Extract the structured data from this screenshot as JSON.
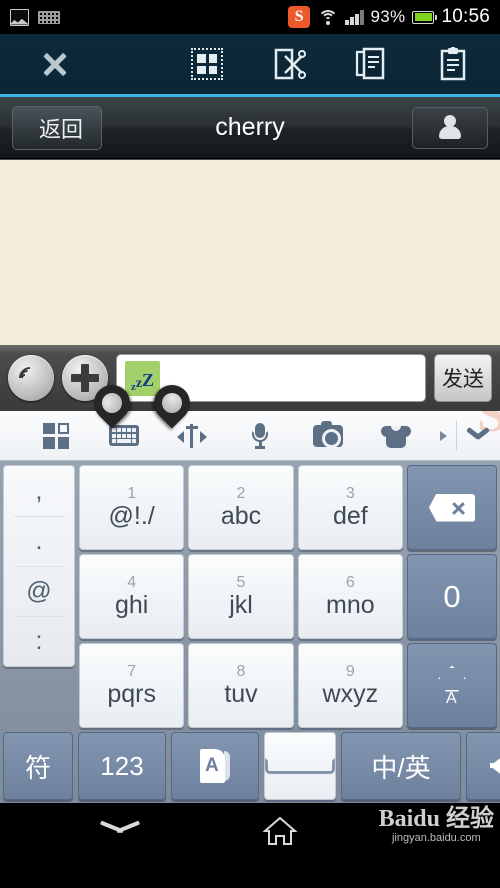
{
  "statusbar": {
    "icons_left": [
      "gallery-icon",
      "keyboard-icon"
    ],
    "sogou_badge": "S",
    "battery_percent": "93%",
    "clock": "10:56"
  },
  "editbar": {
    "close_label": "close-icon",
    "actions": [
      {
        "name": "select-all-icon",
        "label": "全选"
      },
      {
        "name": "cut-icon",
        "label": "剪切"
      },
      {
        "name": "copy-icon",
        "label": "复制"
      },
      {
        "name": "paste-icon",
        "label": "粘贴"
      }
    ]
  },
  "titlebar": {
    "back_label": "返回",
    "title": "cherry",
    "contact_icon": "person-icon"
  },
  "inputbar": {
    "voice_icon": "voice-icon",
    "plus_icon": "plus-icon",
    "emoji": {
      "name": "sleeping-emoji",
      "z_small": "z",
      "z_mid": "z",
      "z_big": "Z",
      "color": "#a4d06a"
    },
    "placeholder": "",
    "send_label": "发送"
  },
  "imebar": {
    "items": [
      {
        "name": "apps-grid-icon"
      },
      {
        "name": "keyboard-icon"
      },
      {
        "name": "cursor-move-icon"
      },
      {
        "name": "microphone-icon"
      },
      {
        "name": "camera-icon"
      },
      {
        "name": "theme-shirt-icon"
      }
    ],
    "more_arrow": "chevron-right-icon",
    "hide_keyboard": "chevron-down-icon",
    "watermark": "S"
  },
  "keyboard": {
    "punctuation": [
      ",",
      ".",
      "@",
      ":"
    ],
    "rows": [
      [
        {
          "num": "1",
          "letters": "@!./",
          "style": "light"
        },
        {
          "num": "2",
          "letters": "abc",
          "style": "light"
        },
        {
          "num": "3",
          "letters": "def",
          "style": "light"
        },
        {
          "num": "",
          "letters": "",
          "style": "dark",
          "icon": "backspace-icon"
        }
      ],
      [
        {
          "num": "4",
          "letters": "ghi",
          "style": "light"
        },
        {
          "num": "5",
          "letters": "jkl",
          "style": "light"
        },
        {
          "num": "6",
          "letters": "mno",
          "style": "light"
        },
        {
          "num": "",
          "letters": "0",
          "style": "dark",
          "icon": ""
        }
      ],
      [
        {
          "num": "7",
          "letters": "pqrs",
          "style": "light"
        },
        {
          "num": "8",
          "letters": "tuv",
          "style": "light"
        },
        {
          "num": "9",
          "letters": "wxyz",
          "style": "light"
        },
        {
          "num": "",
          "letters": "",
          "style": "dark",
          "icon": "shift-icon"
        }
      ]
    ],
    "bottom": {
      "symbols": "符",
      "numbers": "123",
      "dictionary_icon": "dictionary-icon",
      "dictionary_letter": "A",
      "space_icon": "space-icon",
      "lang_toggle": "中/英",
      "enter_icon": "enter-icon"
    }
  },
  "navbar": {
    "back_icon": "chevron-down-icon",
    "home_icon": "home-icon",
    "watermark_main": "Baidu 经验",
    "watermark_sub": "jingyan.baidu.com"
  }
}
